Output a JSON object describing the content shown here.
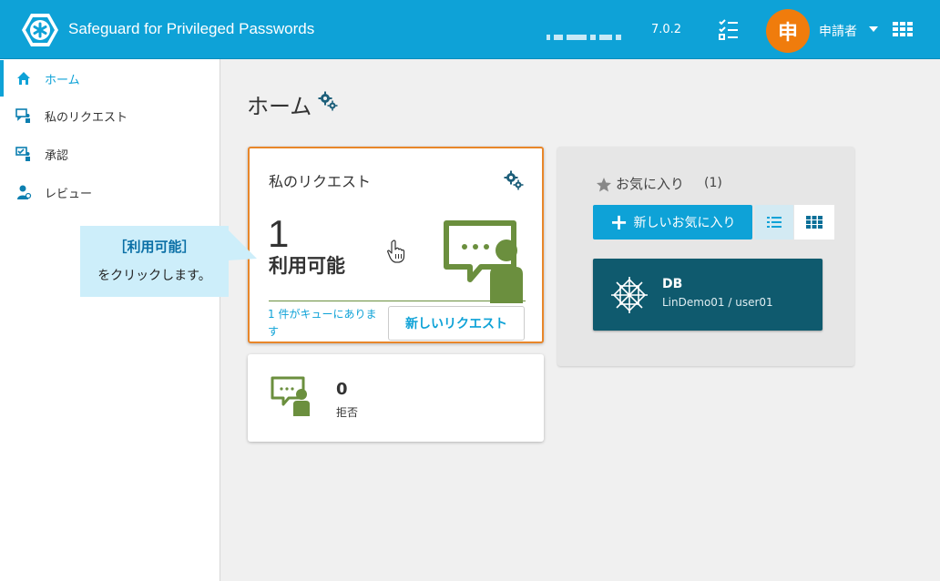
{
  "header": {
    "app_title": "Safeguard for Privileged Passwords",
    "version": "7.0.2",
    "avatar_char": "申",
    "user_name": "申請者",
    "colors": {
      "bar": "#0ea2d7",
      "avatar": "#f07c0c"
    }
  },
  "sidebar": {
    "items": [
      {
        "label": "ホーム",
        "icon": "home-icon",
        "active": true
      },
      {
        "label": "私のリクエスト",
        "icon": "my-requests-icon"
      },
      {
        "label": "承認",
        "icon": "approvals-icon"
      },
      {
        "label": "レビュー",
        "icon": "reviews-icon"
      }
    ]
  },
  "main": {
    "page_title": "ホーム",
    "requests_card": {
      "title": "私のリクエスト",
      "count": "1",
      "status_label": "利用可能",
      "queue_text": "1 件がキューにあります",
      "new_request_label": "新しいリクエスト"
    },
    "rejected_card": {
      "count": "0",
      "label": "拒否"
    },
    "favorites": {
      "title": "お気に入り",
      "count": "(1)",
      "new_favorite_label": "新しいお気に入り",
      "items": [
        {
          "name": "DB",
          "detail": "LinDemo01 / user01"
        }
      ]
    }
  },
  "callout": {
    "title": "［利用可能］",
    "text": "をクリックします。"
  }
}
